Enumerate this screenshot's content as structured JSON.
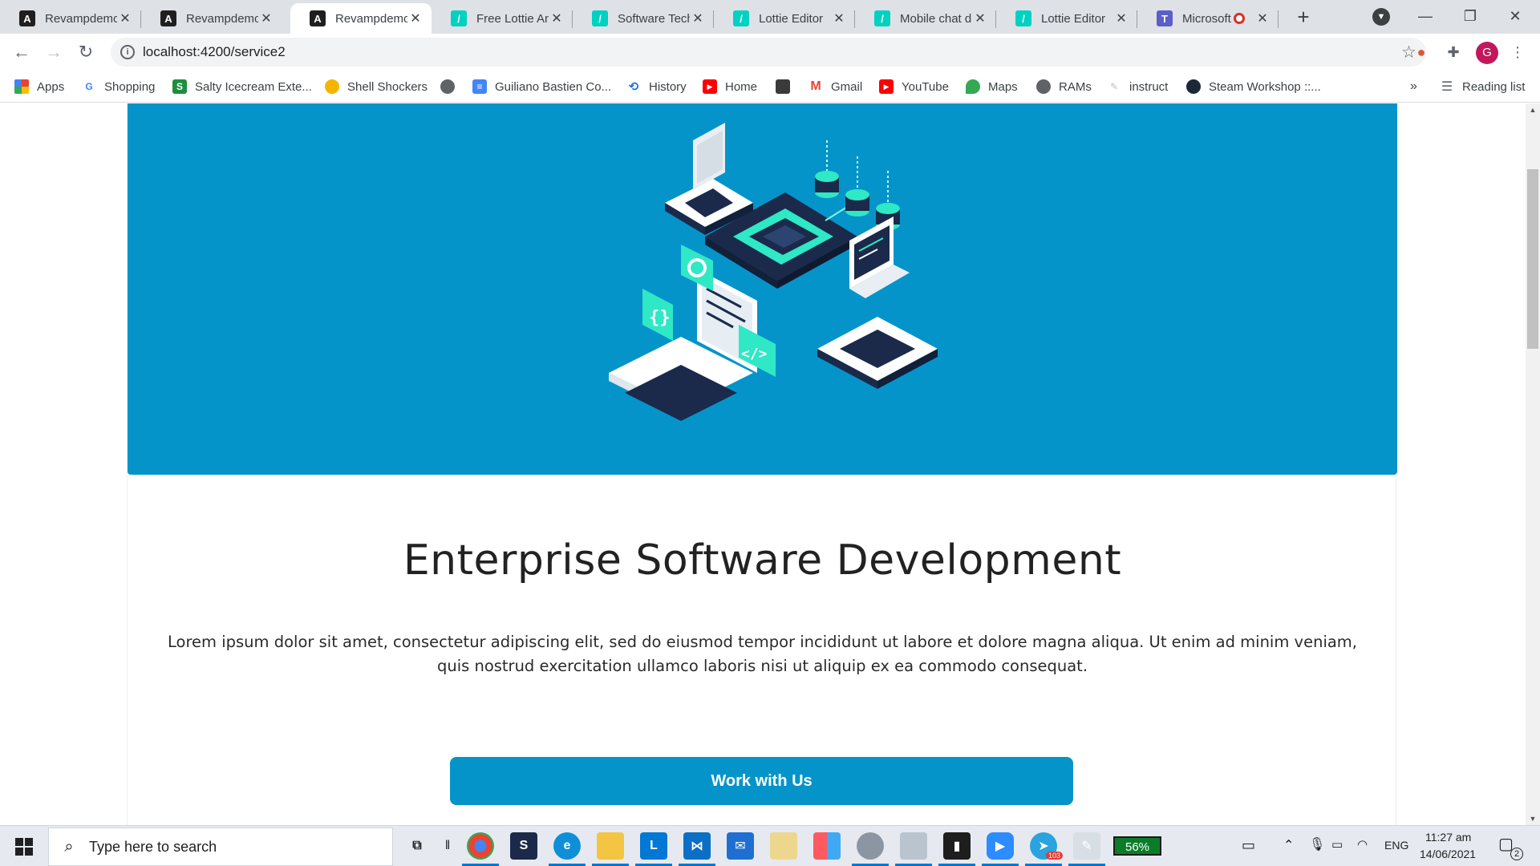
{
  "browser": {
    "tabs": [
      {
        "title": "Revampdemo",
        "favicon": "angular-icon",
        "active": false
      },
      {
        "title": "Revampdemo",
        "favicon": "angular-icon",
        "active": false
      },
      {
        "title": "Revampdemo",
        "favicon": "angular-icon",
        "active": true
      },
      {
        "title": "Free Lottie Ani",
        "favicon": "lottiefiles-icon",
        "active": false
      },
      {
        "title": "Software Techi",
        "favicon": "lottiefiles-icon",
        "active": false
      },
      {
        "title": "Lottie Editor",
        "favicon": "lottiefiles-icon",
        "active": false
      },
      {
        "title": "Mobile chat di",
        "favicon": "lottiefiles-icon",
        "active": false
      },
      {
        "title": "Lottie Editor",
        "favicon": "lottiefiles-icon",
        "active": false
      },
      {
        "title": "Microsoft",
        "favicon": "teams-icon",
        "active": false,
        "recording": true
      }
    ],
    "address_bar": {
      "url": "localhost:4200/service2"
    },
    "bookmarks": [
      {
        "label": "Apps",
        "icon": "apps-grid-icon"
      },
      {
        "label": "Shopping",
        "icon": "google-icon"
      },
      {
        "label": "Salty Icecream Exte...",
        "icon": "extension-icon"
      },
      {
        "label": "Shell Shockers",
        "icon": "egg-icon"
      },
      {
        "label": "",
        "icon": "globe-icon"
      },
      {
        "label": "Guiliano Bastien Co...",
        "icon": "docs-icon"
      },
      {
        "label": "History",
        "icon": "history-icon"
      },
      {
        "label": "Home",
        "icon": "youtube-icon"
      },
      {
        "label": "",
        "icon": "image-icon"
      },
      {
        "label": "Gmail",
        "icon": "gmail-icon"
      },
      {
        "label": "YouTube",
        "icon": "youtube-icon"
      },
      {
        "label": "Maps",
        "icon": "maps-icon"
      },
      {
        "label": "RAMs",
        "icon": "globe-icon"
      },
      {
        "label": "instruct",
        "icon": "feather-icon"
      },
      {
        "label": "Steam Workshop ::...",
        "icon": "steam-icon"
      }
    ],
    "overflow_chevron": "»",
    "reading_list": "Reading list",
    "profile_initial": "G"
  },
  "page": {
    "title": "Enterprise Software Development",
    "description": "Lorem ipsum dolor sit amet, consectetur adipiscing elit, sed do eiusmod tempor incididunt ut labore et dolore magna aliqua. Ut enim ad minim veniam, quis nostrud exercitation ullamco laboris nisi ut aliquip ex ea commodo consequat.",
    "cta_label": "Work with Us"
  },
  "taskbar": {
    "search_placeholder": "Type here to search",
    "battery": "56%",
    "language": "ENG",
    "time": "11:27 am",
    "date": "14/06/2021",
    "notifications_count": "2",
    "telegram_badge": "103"
  },
  "colors": {
    "brand_blue": "#0594c9",
    "accent_teal": "#2ee8c6",
    "dark_navy": "#1b2a4a"
  }
}
